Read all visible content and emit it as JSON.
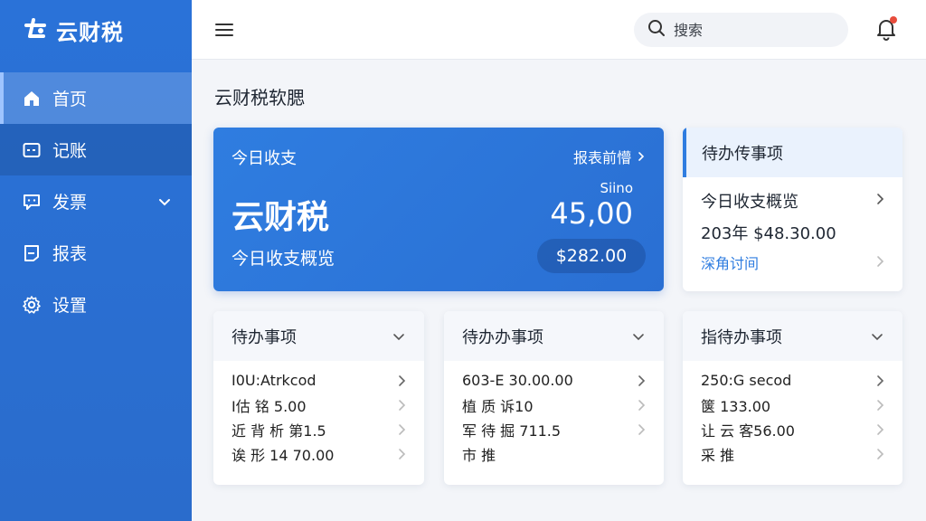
{
  "app": {
    "name": "云财税"
  },
  "sidebar": {
    "items": [
      {
        "label": "首页"
      },
      {
        "label": "记账"
      },
      {
        "label": "发票"
      },
      {
        "label": "报表"
      },
      {
        "label": "设置"
      }
    ]
  },
  "header": {
    "search_placeholder": "搜索"
  },
  "page": {
    "title": "云财税软腮"
  },
  "hero": {
    "label": "今日收支",
    "link": "报表前懵",
    "big_text": "云财税",
    "sub_label": "Siino",
    "amount": "45,00",
    "desc": "今日收支概览",
    "pill": "$282.00"
  },
  "todo_top": {
    "title": "待办传事项",
    "line1": "今日收支概览",
    "line2": "203年  $48.30.00",
    "line3": "深角讨间"
  },
  "cards": [
    {
      "title": "待办事项",
      "rows": [
        "I0U:Atrkcod",
        "I估 铭 5.00",
        "近 背 析 第1.5",
        "诶 形 14  70.00"
      ]
    },
    {
      "title": "待办办事项",
      "rows": [
        "603-E 30.00.00",
        "植 质 诉10",
        "军 待 掘 711.5",
        "市 推"
      ]
    },
    {
      "title": "指待办事项",
      "rows": [
        "250:G secod",
        "箧 133.00",
        "让 云 客56.00",
        "采 推"
      ]
    }
  ],
  "colors": {
    "primary": "#2a72d8",
    "accent": "#2f7de0",
    "alert": "#e74c3c"
  }
}
